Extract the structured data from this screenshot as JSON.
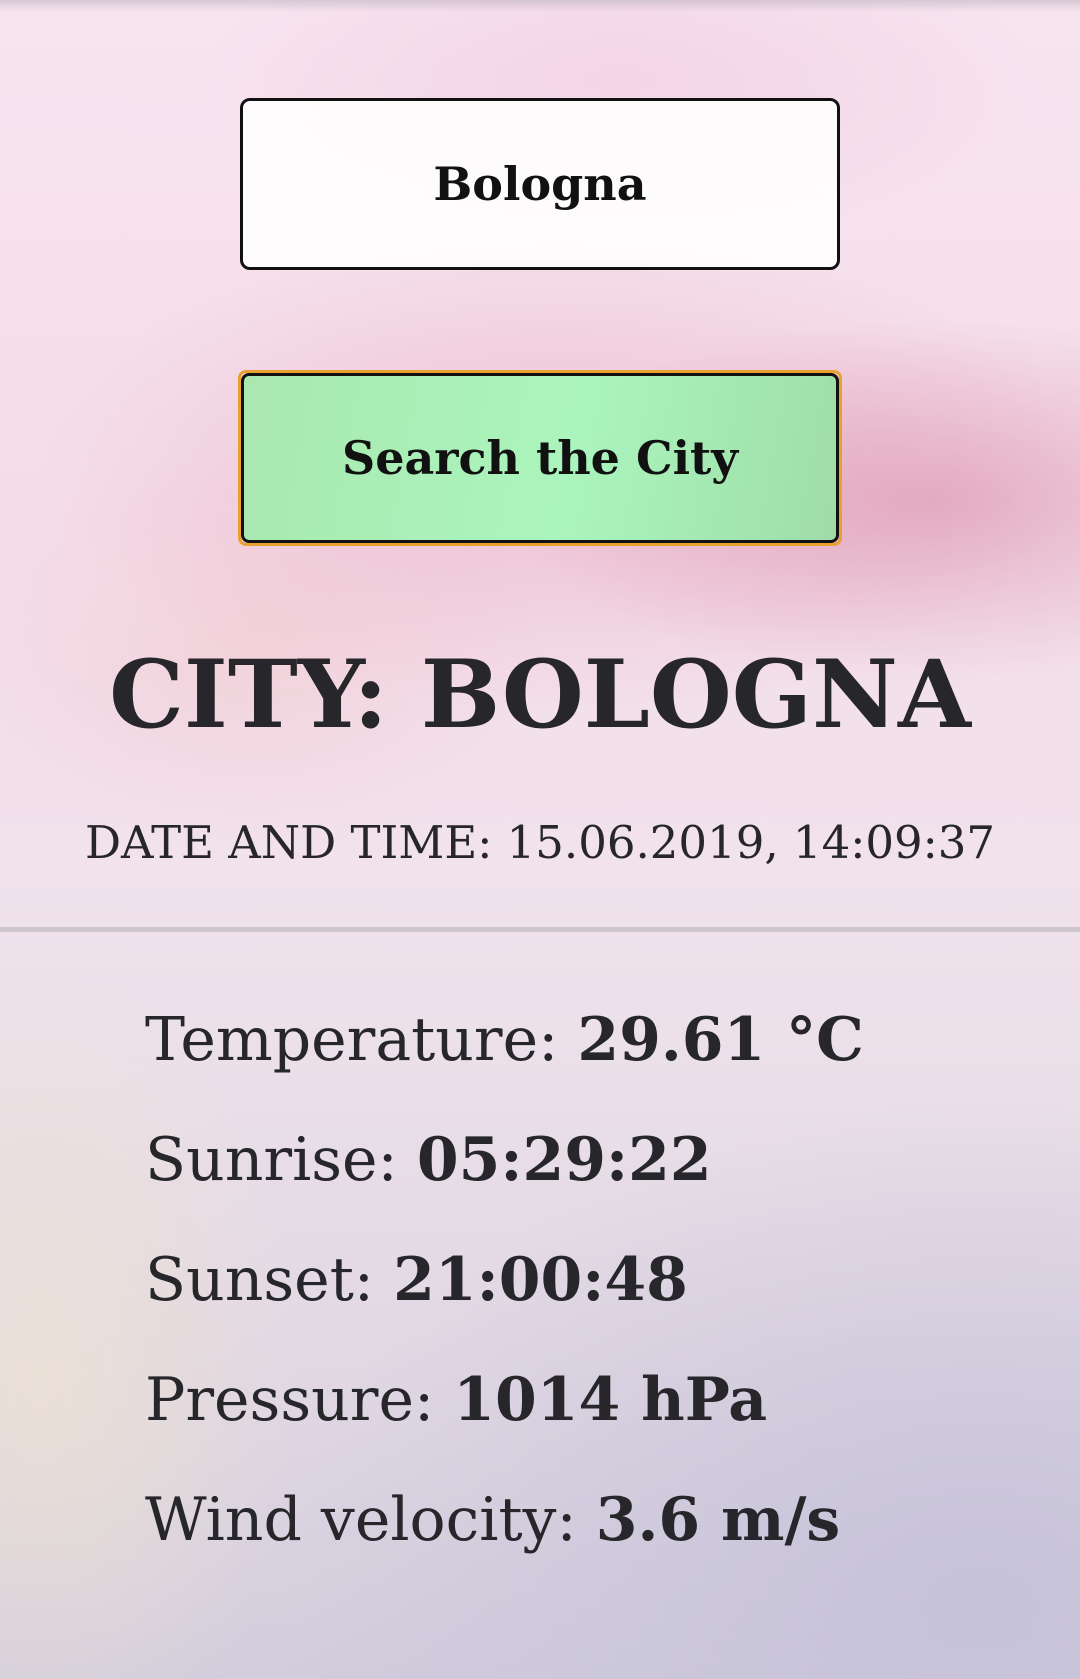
{
  "search": {
    "input_value": "Bologna",
    "button_label": "Search the City",
    "button_color": "#aaf5bd",
    "focus_ring_color": "#e8a030"
  },
  "weather": {
    "city_heading": "CITY: BOLOGNA",
    "datetime": "DATE AND TIME: 15.06.2019, 14:09:37",
    "details": [
      {
        "label": "Temperature: ",
        "value": "29.61 °C"
      },
      {
        "label": "Sunrise: ",
        "value": "05:29:22"
      },
      {
        "label": "Sunset: ",
        "value": "21:00:48"
      },
      {
        "label": "Pressure: ",
        "value": "1014 hPa"
      },
      {
        "label": "Wind velocity: ",
        "value": "3.6 m/s"
      }
    ]
  }
}
